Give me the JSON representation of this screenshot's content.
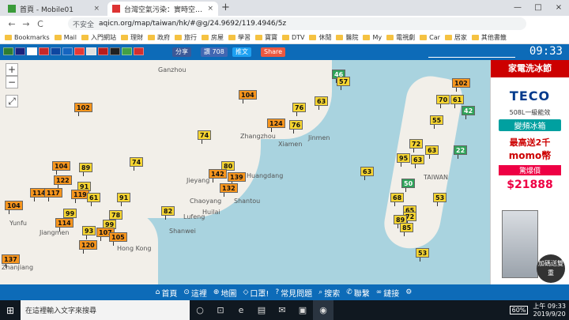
{
  "browser": {
    "tabs": [
      {
        "title": "首頁 - Mobile01",
        "close": "×",
        "active": false,
        "fav_color": "#3a9b3a"
      },
      {
        "title": "台灣空氣污染：實時空氣質量指數",
        "close": "×",
        "active": true,
        "fav_color": "#d33"
      }
    ],
    "new_tab": "+",
    "window_controls": [
      "—",
      "□",
      "×"
    ],
    "nav": {
      "back": "←",
      "forward": "→",
      "reload": "C"
    },
    "omnibox": {
      "security": "不安全",
      "url": "aqicn.org/map/taiwan/hk/#@g/24.9692/119.4946/5z"
    },
    "bookmarks": [
      "Bookmarks",
      "Mail",
      "入門網站",
      "理財",
      "政府",
      "旅行",
      "房屋",
      "學習",
      "寶寶",
      "DTV",
      "休閒",
      "醫院",
      "My",
      "電視劇",
      "Car",
      "居家",
      "其他書籤"
    ]
  },
  "site": {
    "flags": [
      "#2e7d32",
      "#1a237e",
      "#ffffff",
      "#c62828",
      "#0d47a1",
      "#1565c0",
      "#e53935",
      "#e0e0e0",
      "#b71c1c",
      "#212121",
      "#43a047",
      "#d32f2f"
    ],
    "share_fb": "分享",
    "like": "讚 708",
    "tweet": "推文",
    "share": "Share",
    "clock": "09:33"
  },
  "map": {
    "zoom_in": "+",
    "zoom_out": "−",
    "fullscreen": "⤢",
    "place_labels": [
      {
        "text": "Ganzhou"
      },
      {
        "text": "Zhangzhou"
      },
      {
        "text": "Xiamen"
      },
      {
        "text": "Jinmen"
      },
      {
        "text": "Huangdang"
      },
      {
        "text": "Jieyang"
      },
      {
        "text": "Chaoyang"
      },
      {
        "text": "Shantou"
      },
      {
        "text": "Lufeng"
      },
      {
        "text": "Shanwei"
      },
      {
        "text": "Yunfu"
      },
      {
        "text": "Jiangmen"
      },
      {
        "text": "Hong Kong"
      },
      {
        "text": "Zhanjiang"
      },
      {
        "text": "Huilai"
      },
      {
        "text": "TAIWAN"
      }
    ],
    "stations": [
      {
        "v": "46",
        "c": "green"
      },
      {
        "v": "57",
        "c": "yellow"
      },
      {
        "v": "102",
        "c": "orange"
      },
      {
        "v": "104",
        "c": "orange"
      },
      {
        "v": "63",
        "c": "yellow"
      },
      {
        "v": "76",
        "c": "yellow"
      },
      {
        "v": "124",
        "c": "orange"
      },
      {
        "v": "76",
        "c": "yellow"
      },
      {
        "v": "74",
        "c": "yellow"
      },
      {
        "v": "102",
        "c": "orange"
      },
      {
        "v": "70",
        "c": "yellow"
      },
      {
        "v": "61",
        "c": "yellow"
      },
      {
        "v": "55",
        "c": "yellow"
      },
      {
        "v": "42",
        "c": "green"
      },
      {
        "v": "72",
        "c": "yellow"
      },
      {
        "v": "63",
        "c": "yellow"
      },
      {
        "v": "22",
        "c": "green"
      },
      {
        "v": "95",
        "c": "yellow"
      },
      {
        "v": "63",
        "c": "yellow"
      },
      {
        "v": "74",
        "c": "yellow"
      },
      {
        "v": "104",
        "c": "orange"
      },
      {
        "v": "89",
        "c": "yellow"
      },
      {
        "v": "80",
        "c": "yellow"
      },
      {
        "v": "142",
        "c": "orange"
      },
      {
        "v": "139",
        "c": "orange"
      },
      {
        "v": "132",
        "c": "orange"
      },
      {
        "v": "122",
        "c": "orange"
      },
      {
        "v": "91",
        "c": "yellow"
      },
      {
        "v": "114",
        "c": "orange"
      },
      {
        "v": "117",
        "c": "orange"
      },
      {
        "v": "119",
        "c": "orange"
      },
      {
        "v": "61",
        "c": "yellow"
      },
      {
        "v": "91",
        "c": "yellow"
      },
      {
        "v": "104",
        "c": "orange"
      },
      {
        "v": "99",
        "c": "yellow"
      },
      {
        "v": "78",
        "c": "yellow"
      },
      {
        "v": "82",
        "c": "yellow"
      },
      {
        "v": "114",
        "c": "orange"
      },
      {
        "v": "99",
        "c": "yellow"
      },
      {
        "v": "93",
        "c": "yellow"
      },
      {
        "v": "107",
        "c": "orange"
      },
      {
        "v": "105",
        "c": "orange"
      },
      {
        "v": "120",
        "c": "orange"
      },
      {
        "v": "137",
        "c": "orange"
      },
      {
        "v": "68",
        "c": "yellow"
      },
      {
        "v": "65",
        "c": "yellow"
      },
      {
        "v": "72",
        "c": "yellow"
      },
      {
        "v": "89",
        "c": "yellow"
      },
      {
        "v": "85",
        "c": "yellow"
      },
      {
        "v": "53",
        "c": "yellow"
      },
      {
        "v": "53",
        "c": "yellow"
      },
      {
        "v": "50",
        "c": "green"
      },
      {
        "v": "63",
        "c": "yellow"
      }
    ],
    "colors": {
      "green": "#2fa35a",
      "yellow": "#f6d531",
      "orange": "#f7951d"
    }
  },
  "ad": {
    "header": "家電洗冰節",
    "brand": "TECO",
    "line1": "508L一級能效",
    "line2": "變頻冰箱",
    "line3": "最高送2千",
    "line4": "momo幣",
    "line5": "驚爆價",
    "price": "$21888",
    "buy": "加碼送雙重"
  },
  "bottomnav": [
    {
      "icon": "⌂",
      "label": "首頁"
    },
    {
      "icon": "⊙",
      "label": "這裡"
    },
    {
      "icon": "⊕",
      "label": "地圖"
    },
    {
      "icon": "◇",
      "label": "口罩!"
    },
    {
      "icon": "?",
      "label": "常見問題"
    },
    {
      "icon": "⌕",
      "label": "搜索"
    },
    {
      "icon": "✆",
      "label": "聯繫"
    },
    {
      "icon": "∞",
      "label": "鏈接"
    },
    {
      "icon": "⚙",
      "label": ""
    }
  ],
  "taskbar": {
    "start": "⊞",
    "search_placeholder": "在這裡輸入文字來搜尋",
    "apps": [
      "○",
      "⊡",
      "e",
      "▤",
      "✉",
      "▣",
      "◉"
    ],
    "battery": "60%",
    "time": "上午 09:33",
    "date": "2019/9/20"
  }
}
